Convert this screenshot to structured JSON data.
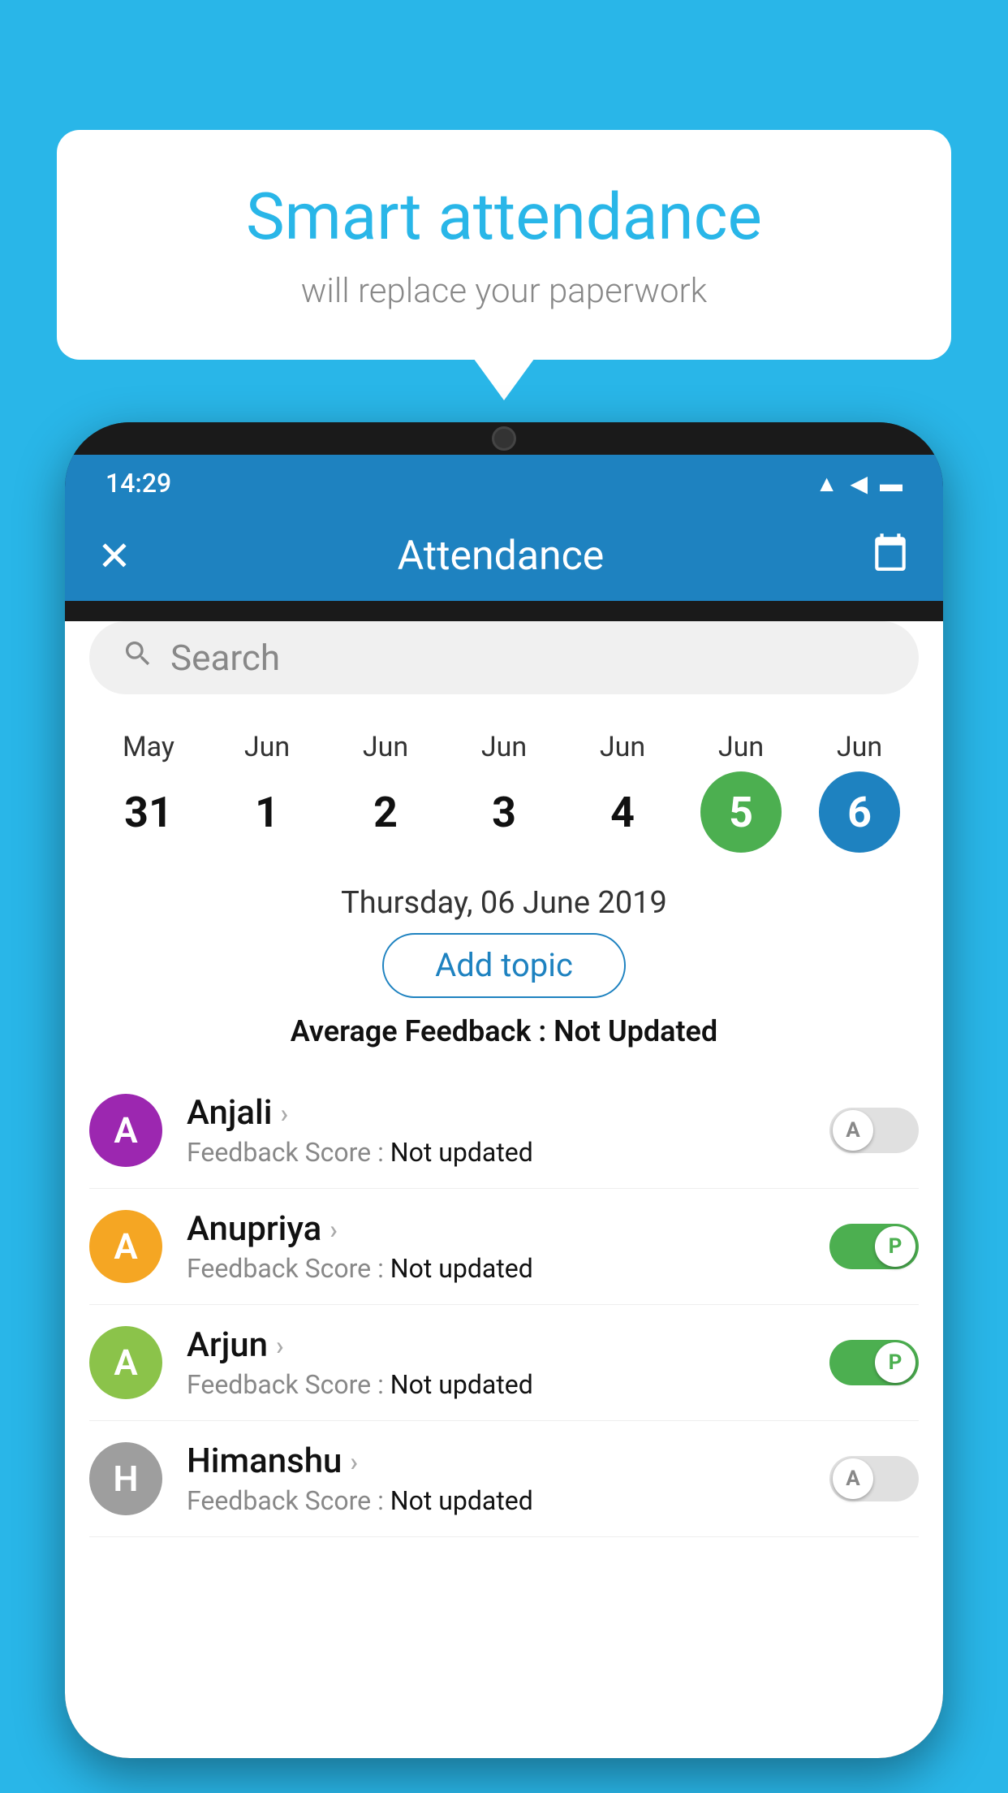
{
  "background_color": "#29b6e8",
  "bubble": {
    "title": "Smart attendance",
    "subtitle": "will replace your paperwork"
  },
  "phone": {
    "status_bar": {
      "time": "14:29",
      "icons": [
        "wifi",
        "signal",
        "battery"
      ]
    },
    "header": {
      "close_label": "✕",
      "title": "Attendance",
      "calendar_icon": "📅"
    },
    "search": {
      "placeholder": "Search"
    },
    "dates": [
      {
        "month": "May",
        "day": "31",
        "selected": false
      },
      {
        "month": "Jun",
        "day": "1",
        "selected": false
      },
      {
        "month": "Jun",
        "day": "2",
        "selected": false
      },
      {
        "month": "Jun",
        "day": "3",
        "selected": false
      },
      {
        "month": "Jun",
        "day": "4",
        "selected": false
      },
      {
        "month": "Jun",
        "day": "5",
        "selected": "green"
      },
      {
        "month": "Jun",
        "day": "6",
        "selected": "blue"
      }
    ],
    "selected_date_label": "Thursday, 06 June 2019",
    "add_topic_label": "Add topic",
    "avg_feedback_label": "Average Feedback :",
    "avg_feedback_value": "Not Updated",
    "students": [
      {
        "name": "Anjali",
        "avatar_letter": "A",
        "avatar_color": "#9c27b0",
        "feedback_label": "Feedback Score :",
        "feedback_value": "Not updated",
        "toggle_state": "off",
        "toggle_letter": "A"
      },
      {
        "name": "Anupriya",
        "avatar_letter": "A",
        "avatar_color": "#f5a623",
        "feedback_label": "Feedback Score :",
        "feedback_value": "Not updated",
        "toggle_state": "on",
        "toggle_letter": "P"
      },
      {
        "name": "Arjun",
        "avatar_letter": "A",
        "avatar_color": "#8bc34a",
        "feedback_label": "Feedback Score :",
        "feedback_value": "Not updated",
        "toggle_state": "on",
        "toggle_letter": "P"
      },
      {
        "name": "Himanshu",
        "avatar_letter": "H",
        "avatar_color": "#9e9e9e",
        "feedback_label": "Feedback Score :",
        "feedback_value": "Not updated",
        "toggle_state": "off",
        "toggle_letter": "A"
      }
    ]
  }
}
